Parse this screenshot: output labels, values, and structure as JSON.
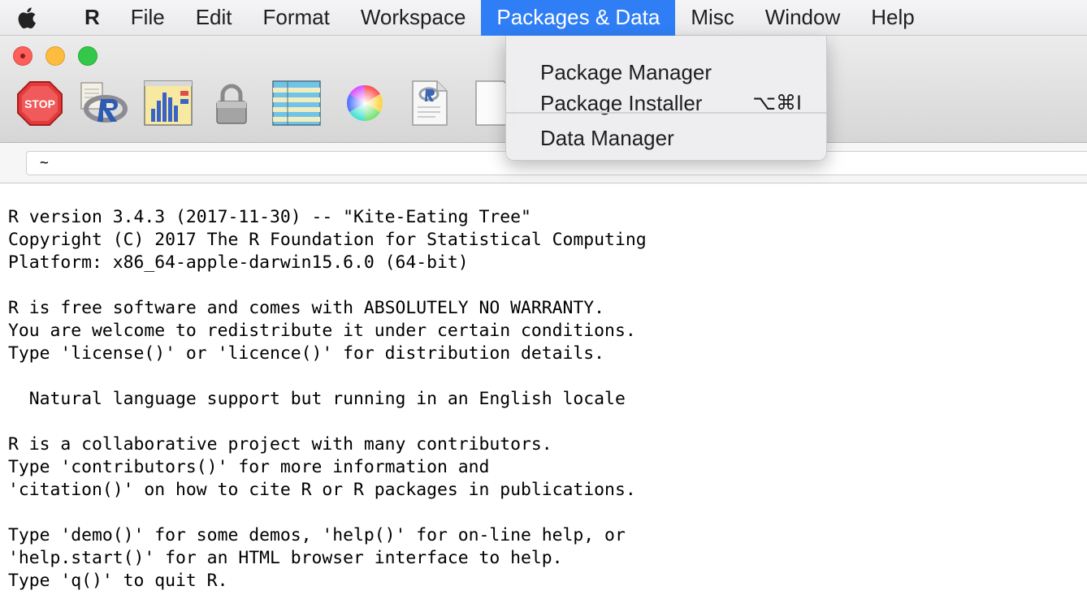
{
  "menubar": {
    "app_name": "R",
    "items": [
      "File",
      "Edit",
      "Format",
      "Workspace",
      "Packages & Data",
      "Misc",
      "Window",
      "Help"
    ],
    "active_item": "Packages & Data"
  },
  "toolbar": {
    "icons": [
      "stop-icon",
      "source-script-icon",
      "quartz-plot-icon",
      "lock-icon",
      "data-table-icon",
      "color-wheel-icon",
      "new-document-icon",
      "blank-document-icon"
    ],
    "stop_label": "STOP"
  },
  "pathbar": {
    "path": "~"
  },
  "dropdown": {
    "items": [
      {
        "label": "Package Manager",
        "shortcut": ""
      },
      {
        "label": "Package Installer",
        "shortcut": "⌥⌘I"
      },
      {
        "label": "Data Manager",
        "shortcut": ""
      }
    ]
  },
  "console": {
    "lines": [
      "R version 3.4.3 (2017-11-30) -- \"Kite-Eating Tree\"",
      "Copyright (C) 2017 The R Foundation for Statistical Computing",
      "Platform: x86_64-apple-darwin15.6.0 (64-bit)",
      "",
      "R is free software and comes with ABSOLUTELY NO WARRANTY.",
      "You are welcome to redistribute it under certain conditions.",
      "Type 'license()' or 'licence()' for distribution details.",
      "",
      "  Natural language support but running in an English locale",
      "",
      "R is a collaborative project with many contributors.",
      "Type 'contributors()' for more information and",
      "'citation()' on how to cite R or R packages in publications.",
      "",
      "Type 'demo()' for some demos, 'help()' for on-line help, or",
      "'help.start()' for an HTML browser interface to help.",
      "Type 'q()' to quit R."
    ]
  },
  "colors": {
    "menu_highlight": "#2f7ef5",
    "close": "#fc605b",
    "minimize": "#fdbc40",
    "maximize": "#34c84a"
  }
}
